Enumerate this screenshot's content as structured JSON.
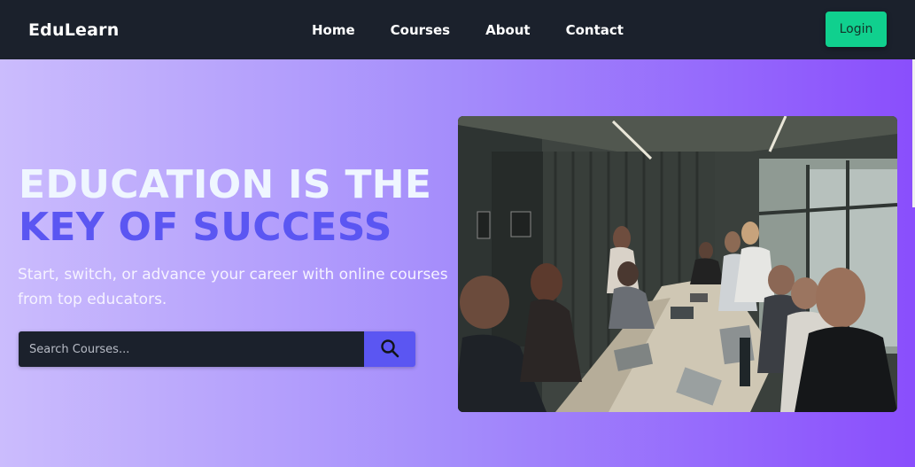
{
  "navbar": {
    "logo": "EduLearn",
    "links": [
      {
        "label": "Home"
      },
      {
        "label": "Courses"
      },
      {
        "label": "About"
      },
      {
        "label": "Contact"
      }
    ],
    "login_label": "Login"
  },
  "hero": {
    "headline_line1": "EDUCATION IS THE",
    "headline_line2": "KEY OF SUCCESS",
    "subtitle": "Start, switch, or advance your career with online courses from top educators.",
    "search": {
      "placeholder": "Search Courses..."
    }
  },
  "colors": {
    "navbar_bg": "#1b212c",
    "accent": "#5b56f2",
    "login_bg": "#10d08e",
    "hero_gradient_start": "#cbbcfd",
    "hero_gradient_end": "#8a4efc"
  },
  "icons": {
    "search": "search-icon"
  }
}
